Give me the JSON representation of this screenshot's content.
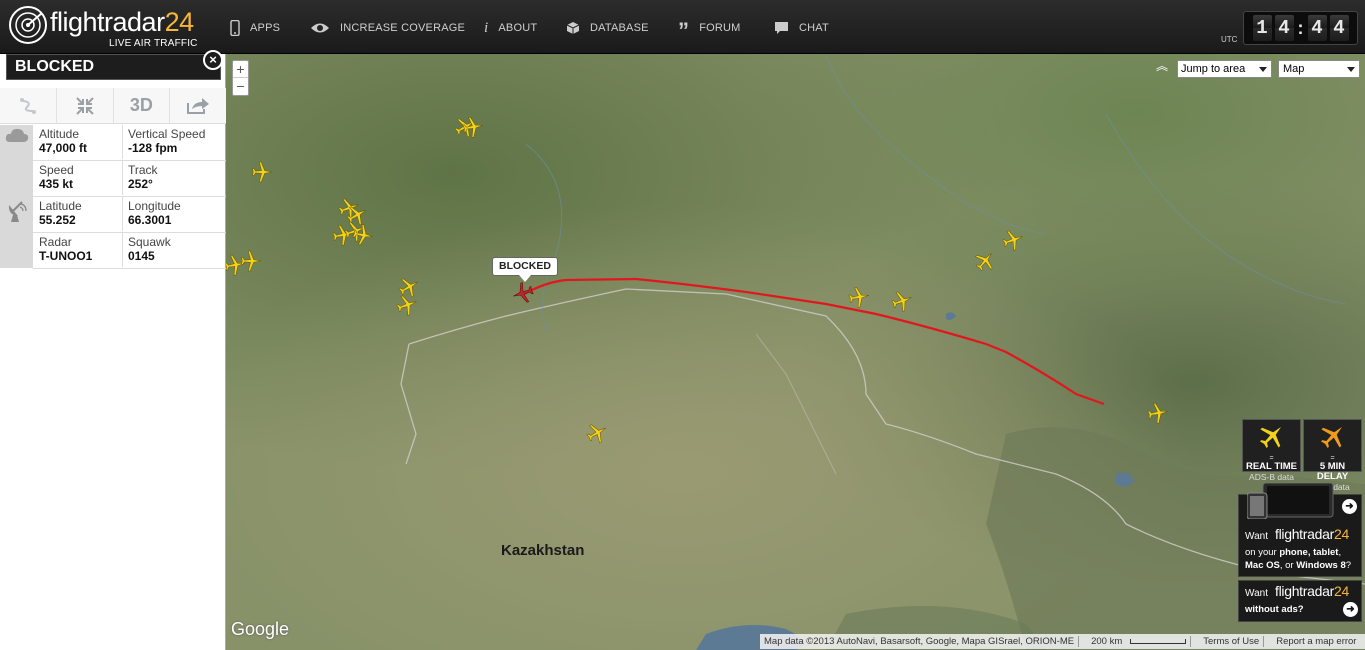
{
  "header": {
    "logo_text": "flightradar",
    "logo_num": "24",
    "logo_sub": "LIVE AIR TRAFFIC",
    "nav": [
      {
        "label": "APPS",
        "icon": "phone-icon"
      },
      {
        "label": "INCREASE COVERAGE",
        "icon": "eye-icon"
      },
      {
        "label": "ABOUT",
        "icon": "info-icon"
      },
      {
        "label": "DATABASE",
        "icon": "box-icon"
      },
      {
        "label": "FORUM",
        "icon": "quote-icon"
      },
      {
        "label": "CHAT",
        "icon": "chat-bubble-icon"
      }
    ],
    "utc_label": "UTC",
    "clock": {
      "h1": "1",
      "h2": "4",
      "sep": ":",
      "m1": "4",
      "m2": "4"
    }
  },
  "panel": {
    "title": "BLOCKED",
    "close": "×",
    "tools": [
      {
        "name": "route-tool",
        "icon": "route-icon"
      },
      {
        "name": "fit-tool",
        "icon": "collapse-arrows-icon"
      },
      {
        "name": "3d-tool",
        "label": "3D"
      },
      {
        "name": "share-tool",
        "icon": "share-icon"
      }
    ],
    "fields": {
      "altitude_label": "Altitude",
      "altitude": "47,000 ft",
      "vspeed_label": "Vertical Speed",
      "vspeed": "-128 fpm",
      "speed_label": "Speed",
      "speed": "435 kt",
      "track_label": "Track",
      "track": "252°",
      "lat_label": "Latitude",
      "lat": "55.252",
      "lon_label": "Longitude",
      "lon": "66.3001",
      "radar_label": "Radar",
      "radar": "T-UNOO1",
      "squawk_label": "Squawk",
      "squawk": "0145"
    }
  },
  "map": {
    "zoom_in": "+",
    "zoom_out": "−",
    "jump_label": "Jump to area",
    "maptype_label": "Map",
    "callout": "BLOCKED",
    "country_label": "Kazakhstan",
    "google": "Google",
    "attribution": "Map data ©2013 AutoNavi, Basarsoft, Google, Mapa GISrael, ORION-ME",
    "scale": "200 km",
    "terms": "Terms of Use",
    "report": "Report a map error",
    "route_color": "#e0181e",
    "plane_color": "#f2d21a"
  },
  "promos": {
    "realtime_eq": "=",
    "realtime": "REAL TIME",
    "realtime_sub": "ADS-B data",
    "delay_eq": "=",
    "delay": "5 MIN DELAY",
    "delay_sub": "FAA data",
    "want1": "Want",
    "brand1": "flightradar",
    "brand1_num": "24",
    "line1a": "on your ",
    "line1b": "phone, tablet",
    "line1c": "Mac OS",
    "line1d": ", or ",
    "line1e": "Windows 8",
    "line1f": "?",
    "want2": "Want",
    "brand2": "flightradar",
    "brand2_num": "24",
    "line2": "without ads?"
  }
}
